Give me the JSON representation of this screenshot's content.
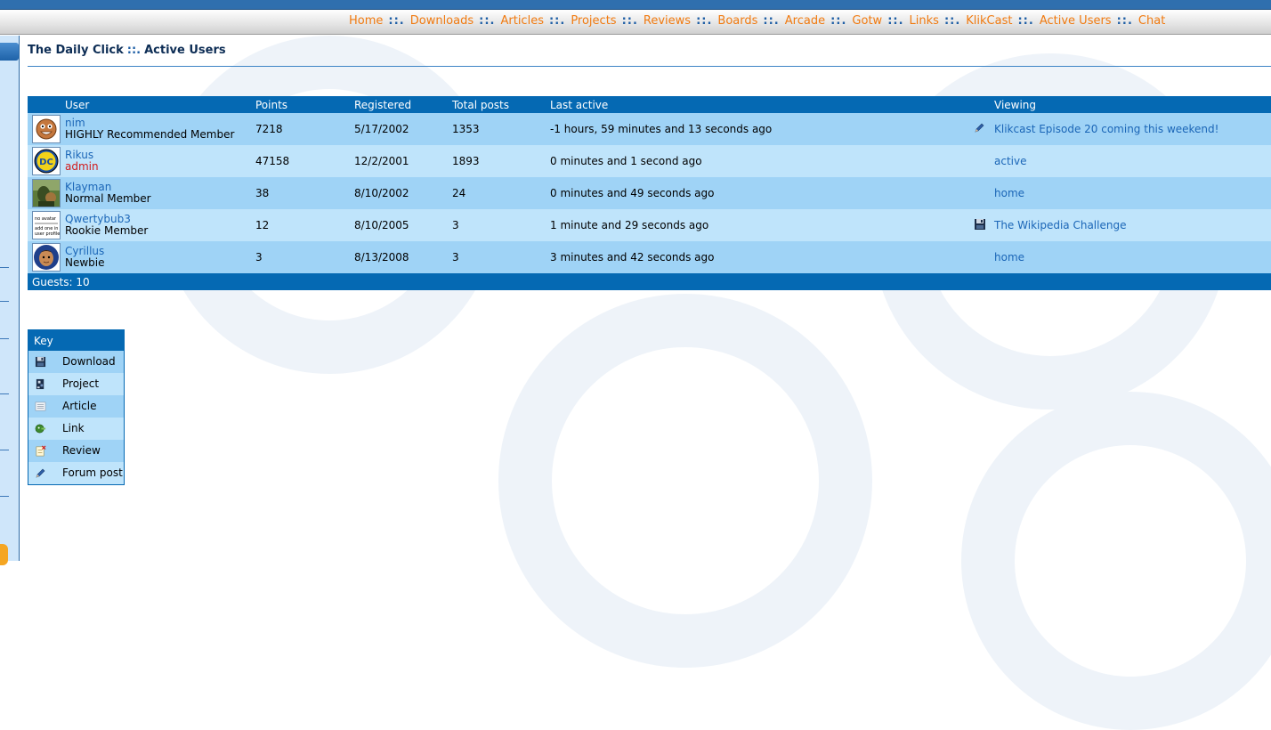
{
  "nav": {
    "items": [
      "Home",
      "Downloads",
      "Articles",
      "Projects",
      "Reviews",
      "Boards",
      "Arcade",
      "Gotw",
      "Links",
      "KlikCast",
      "Active Users",
      "Chat"
    ],
    "separator": "::."
  },
  "page": {
    "site": "The Daily Click",
    "separator": "::.",
    "section": "Active Users"
  },
  "table": {
    "headers": [
      "User",
      "Points",
      "Registered",
      "Total posts",
      "Last active",
      "Viewing"
    ],
    "rows": [
      {
        "name": "nim",
        "rank": "HIGHLY Recommended Member",
        "points": "7218",
        "registered": "5/17/2002",
        "posts": "1353",
        "last_active": "-1 hours, 59 minutes and 13 seconds ago",
        "viewing_icon": "pencil-icon",
        "viewing": "Klikcast Episode 20 coming this weekend!"
      },
      {
        "name": "Rikus",
        "rank": "admin",
        "points": "47158",
        "registered": "12/2/2001",
        "posts": "1893",
        "last_active": "0 minutes and 1 second ago",
        "viewing_icon": "",
        "viewing": "active"
      },
      {
        "name": "Klayman",
        "rank": "Normal Member",
        "points": "38",
        "registered": "8/10/2002",
        "posts": "24",
        "last_active": "0 minutes and 49 seconds ago",
        "viewing_icon": "",
        "viewing": "home"
      },
      {
        "name": "Qwertybub3",
        "rank": "Rookie Member",
        "points": "12",
        "registered": "8/10/2005",
        "posts": "3",
        "last_active": "1 minute and 29 seconds ago",
        "viewing_icon": "floppy-disk-icon",
        "viewing": "The Wikipedia Challenge"
      },
      {
        "name": "Cyrillus",
        "rank": "Newbie",
        "points": "3",
        "registered": "8/13/2008",
        "posts": "3",
        "last_active": "3 minutes and 42 seconds ago",
        "viewing_icon": "",
        "viewing": "home"
      }
    ],
    "no_avatar_text": [
      "no avatar",
      "add one in",
      "user profile"
    ],
    "guests": "Guests: 10"
  },
  "key": {
    "title": "Key",
    "items": [
      {
        "label": "Download",
        "icon": "floppy-disk-icon"
      },
      {
        "label": "Project",
        "icon": "project-icon"
      },
      {
        "label": "Article",
        "icon": "article-icon"
      },
      {
        "label": "Link",
        "icon": "link-icon"
      },
      {
        "label": "Review",
        "icon": "review-icon"
      },
      {
        "label": "Forum post",
        "icon": "pencil-icon"
      }
    ]
  },
  "colors": {
    "nav_link": "#f07a10",
    "nav_separator": "#1f5fa6",
    "header_blue": "#0569b3",
    "row_dark": "#9fd3f6",
    "row_light": "#bfe4fb",
    "link": "#1b66b7",
    "admin": "#d21a1a"
  }
}
